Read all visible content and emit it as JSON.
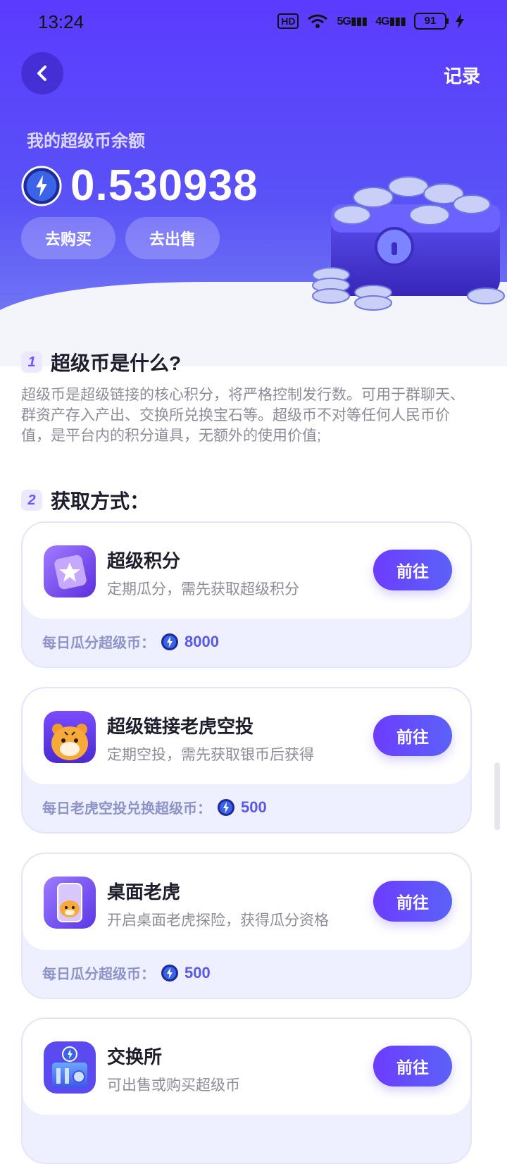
{
  "status_bar": {
    "time": "13:24",
    "hd": "HD",
    "net1": "5G",
    "net2": "4G",
    "battery": "91"
  },
  "header": {
    "back_icon": "chevron-left-icon",
    "record_label": "记录",
    "balance_label": "我的超级币余额",
    "balance_value": "0.530938",
    "buy_label": "去购买",
    "sell_label": "去出售"
  },
  "section1": {
    "number": "1",
    "title": "超级币是什么?",
    "description": "超级币是超级链接的核心积分，将严格控制发行数。可用于群聊天、群资产存入产出、交换所兑换宝石等。超级币不对等任何人民币价值，是平台内的积分道具，无额外的使用价值;"
  },
  "section2": {
    "number": "2",
    "title": "获取方式："
  },
  "cards": [
    {
      "icon": "star-card-icon",
      "title": "超级积分",
      "subtitle": "定期瓜分，需先获取超级积分",
      "button": "前往",
      "footer_label": "每日瓜分超级币：",
      "footer_amount": "8000"
    },
    {
      "icon": "tiger-icon",
      "title": "超级链接老虎空投",
      "subtitle": "定期空投，需先获取银币后获得",
      "button": "前往",
      "footer_label": "每日老虎空投兑换超级币：",
      "footer_amount": "500"
    },
    {
      "icon": "desktop-tiger-icon",
      "title": "桌面老虎",
      "subtitle": "开启桌面老虎探险，获得瓜分资格",
      "button": "前往",
      "footer_label": "每日瓜分超级币：",
      "footer_amount": "500"
    },
    {
      "icon": "exchange-building-icon",
      "title": "交换所",
      "subtitle": "可出售或购买超级币",
      "button": "前往"
    }
  ],
  "colors": {
    "brand": "#5b3bff",
    "accent_button": "#6d3cff",
    "amount": "#5a58e6"
  }
}
